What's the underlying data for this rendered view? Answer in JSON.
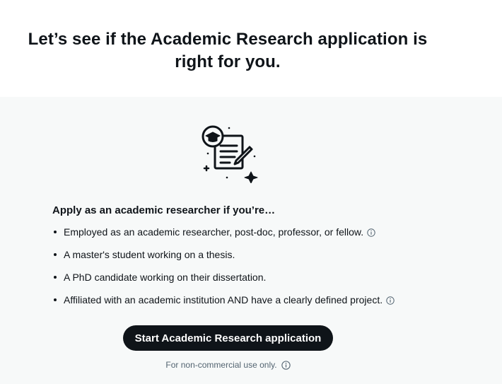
{
  "heading": {
    "title": "Let’s see if the Academic Research application is right for you."
  },
  "intro": {
    "lead": "Apply as an academic researcher if you’re…"
  },
  "criteria": [
    {
      "text": "Employed as an academic researcher, post-doc, professor, or fellow.",
      "has_info": true
    },
    {
      "text": "A master's student working on a thesis.",
      "has_info": false
    },
    {
      "text": "A PhD candidate working on their dissertation.",
      "has_info": false
    },
    {
      "text": "Affiliated with an academic institution AND have a clearly defined project.",
      "has_info": true
    }
  ],
  "cta": {
    "label": "Start Academic Research application",
    "footnote": "For non-commercial use only."
  },
  "icons": {
    "illustration": "graduation-document-pencil-icon",
    "info": "info-circle-icon"
  },
  "colors": {
    "text": "#0f1419",
    "muted": "#536471",
    "button_bg": "#0f1419",
    "button_text": "#ffffff",
    "header_bg": "#ffffff",
    "panel_bg": "#f7f9f9"
  }
}
